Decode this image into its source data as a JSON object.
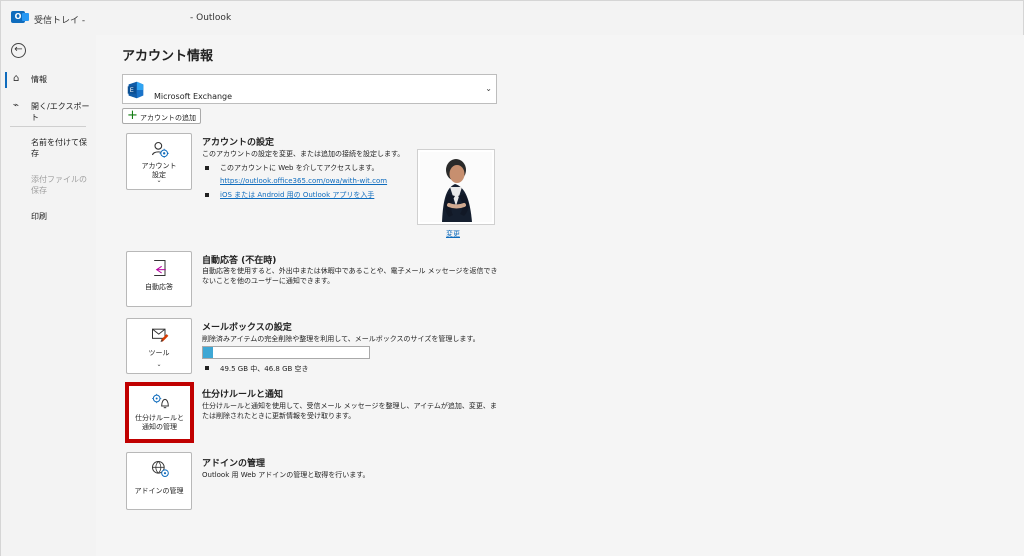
{
  "window": {
    "app_icon_letter": "O",
    "title_left": "受信トレイ -",
    "title_center": "- Outlook"
  },
  "sidebar": {
    "items": [
      {
        "label": "情報",
        "icon": "home-icon",
        "selected": true
      },
      {
        "label": "開く/エクスポート",
        "icon": "folder-open-icon",
        "selected": false
      },
      {
        "label": "名前を付けて保存",
        "selected": false
      },
      {
        "label": "添付ファイルの保存",
        "disabled": true
      },
      {
        "label": "印刷",
        "selected": false
      }
    ]
  },
  "account_info": {
    "page_title": "アカウント情報",
    "account_type": "Microsoft Exchange",
    "add_account_label": "アカウントの追加",
    "profile_change_label": "変更"
  },
  "settings": {
    "title": "アカウントの設定",
    "tile_label_line1": "アカウント",
    "tile_label_line2": "設定",
    "description": "このアカウントの設定を変更、または追加の接続を設定します。",
    "bullet_web": "このアカウントに Web を介してアクセスします。",
    "web_link": "https://outlook.office365.com/owa/with-wit.com",
    "mobile_link": "iOS または Android 用の Outlook アプリを入手"
  },
  "auto_reply": {
    "title": "自動応答 (不在時)",
    "tile_label": "自動応答",
    "description": "自動応答を使用すると、外出中または休暇中であることや、電子メール メッセージを返信できないことを他のユーザーに通知できます。"
  },
  "mailbox": {
    "title": "メールボックスの設定",
    "tile_label": "ツール",
    "description": "削除済みアイテムの完全削除や整理を利用して、メールボックスのサイズを管理します。",
    "usage_fraction": 0.06,
    "quota_text": "49.5 GB 中、46.8 GB 空き"
  },
  "rules": {
    "title": "仕分けルールと通知",
    "tile_label_line1": "仕分けルールと",
    "tile_label_line2": "通知の管理",
    "description": "仕分けルールと通知を使用して、受信メール メッセージを整理し、アイテムが追加、変更、または削除されたときに更新情報を受け取ります。"
  },
  "addins": {
    "title": "アドインの管理",
    "tile_label": "アドインの管理",
    "description": "Outlook 用 Web アドインの管理と取得を行います。"
  },
  "colors": {
    "accent": "#0f6cbd",
    "highlight_border": "#c00000",
    "quota_fill": "#3ea7d4",
    "link": "#0f6cbd"
  }
}
